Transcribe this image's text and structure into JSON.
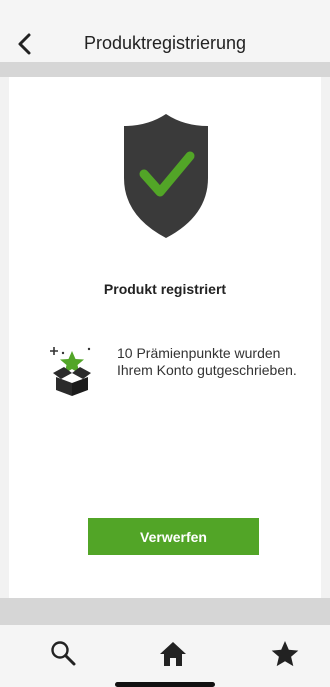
{
  "header": {
    "title": "Produktregistrierung"
  },
  "card": {
    "status_title": "Produkt registriert",
    "reward_text": "10 Prämienpunkte wurden Ihrem Konto gutgeschrieben.",
    "discard_label": "Verwerfen"
  },
  "icons": {
    "back": "chevron-left-icon",
    "shield": "shield-check-icon",
    "reward": "gift-box-star-icon",
    "search": "search-icon",
    "home": "home-icon",
    "favorites": "star-icon"
  },
  "colors": {
    "accent_green": "#52a527",
    "shield_gray": "#3a3a3a"
  }
}
